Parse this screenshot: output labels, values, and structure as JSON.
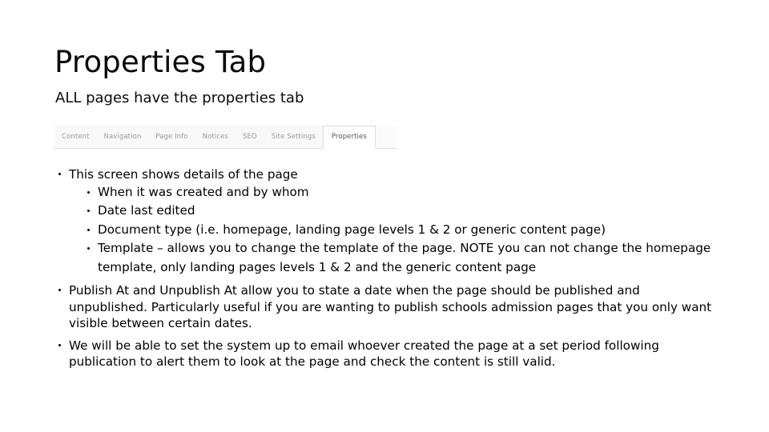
{
  "slide": {
    "title": "Properties Tab",
    "subtitle": "ALL pages have the properties tab"
  },
  "tabstrip": {
    "tabs": [
      {
        "label": "Content",
        "active": false
      },
      {
        "label": "Navigation",
        "active": false
      },
      {
        "label": "Page Info",
        "active": false
      },
      {
        "label": "Notices",
        "active": false
      },
      {
        "label": "SEO",
        "active": false
      },
      {
        "label": "Site Settings",
        "active": false
      },
      {
        "label": "Properties",
        "active": true
      }
    ],
    "active_tab": "Properties",
    "colors": {
      "strip_background": "#f8f8f8",
      "inactive_text": "#9a9a9a",
      "active_text": "#555555",
      "active_background": "#ffffff",
      "border": "#dcdcdc"
    }
  },
  "body": {
    "bullets": [
      {
        "text": "This screen shows details of the page",
        "sub": [
          "When it was created and by whom",
          "Date last edited",
          "Document type (i.e. homepage, landing page levels 1 & 2 or generic content page)",
          "Template – allows you to change the template of the page. NOTE you can not change the homepage template, only landing pages levels 1 & 2 and the generic content page"
        ]
      },
      {
        "text": "Publish At and Unpublish At allow you to state a date when the page should be published and unpublished. Particularly useful if you are wanting to publish schools admission pages that you only want visible between certain dates.",
        "sub": []
      },
      {
        "text": "We will be able to set the system up to email whoever created the page at a set period following publication to alert them to look at the page and check the content is still valid.",
        "sub": []
      }
    ]
  }
}
